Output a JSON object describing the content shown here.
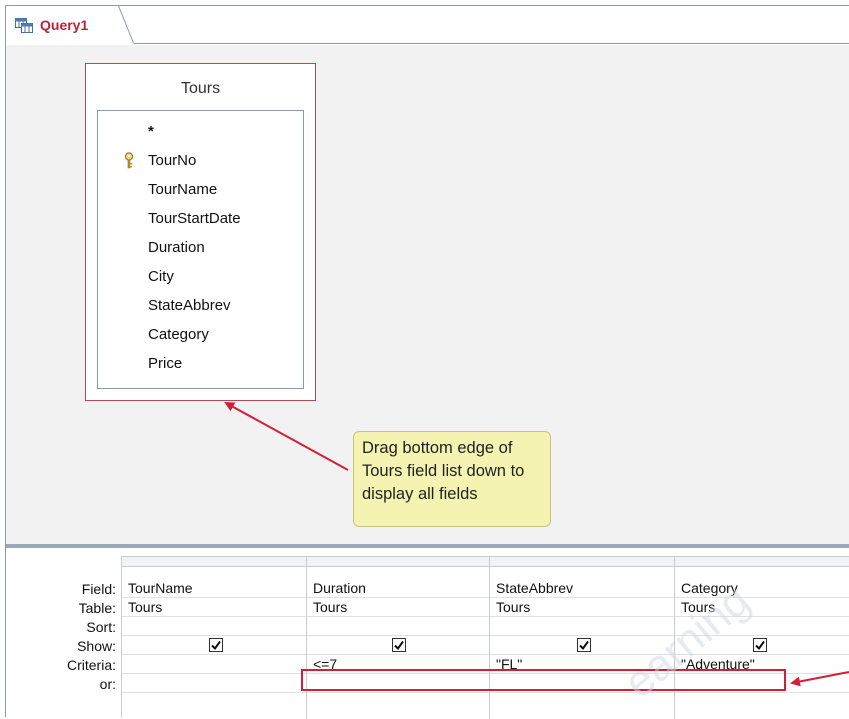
{
  "tab": {
    "title": "Query1"
  },
  "field_list": {
    "title": "Tours",
    "fields": [
      {
        "label": "*",
        "primary_key": false
      },
      {
        "label": "TourNo",
        "primary_key": true
      },
      {
        "label": "TourName",
        "primary_key": false
      },
      {
        "label": "TourStartDate",
        "primary_key": false
      },
      {
        "label": "Duration",
        "primary_key": false
      },
      {
        "label": "City",
        "primary_key": false
      },
      {
        "label": "StateAbbrev",
        "primary_key": false
      },
      {
        "label": "Category",
        "primary_key": false
      },
      {
        "label": "Price",
        "primary_key": false
      }
    ]
  },
  "callout": {
    "line1": "Drag bottom edge of",
    "line2": "Tours field list down to",
    "line3": "display all fields"
  },
  "grid": {
    "row_labels": {
      "field": "Field:",
      "table": "Table:",
      "sort": "Sort:",
      "show": "Show:",
      "criteria": "Criteria:",
      "or": "or:"
    },
    "columns": [
      {
        "field": "TourName",
        "table": "Tours",
        "sort": "",
        "show": true,
        "criteria": "",
        "or": ""
      },
      {
        "field": "Duration",
        "table": "Tours",
        "sort": "",
        "show": true,
        "criteria": "<=7",
        "or": ""
      },
      {
        "field": "StateAbbrev",
        "table": "Tours",
        "sort": "",
        "show": true,
        "criteria": "\"FL\"",
        "or": ""
      },
      {
        "field": "Category",
        "table": "Tours",
        "sort": "",
        "show": true,
        "criteria": "\"Adventure\"",
        "or": ""
      }
    ]
  },
  "colors": {
    "tab_title": "#b3263a",
    "field_list_border": "#b24a55",
    "callout_bg": "#f5f3b2",
    "annotation_red": "#d11f37",
    "design_bg": "#f2f2f2"
  },
  "watermark": "earning"
}
